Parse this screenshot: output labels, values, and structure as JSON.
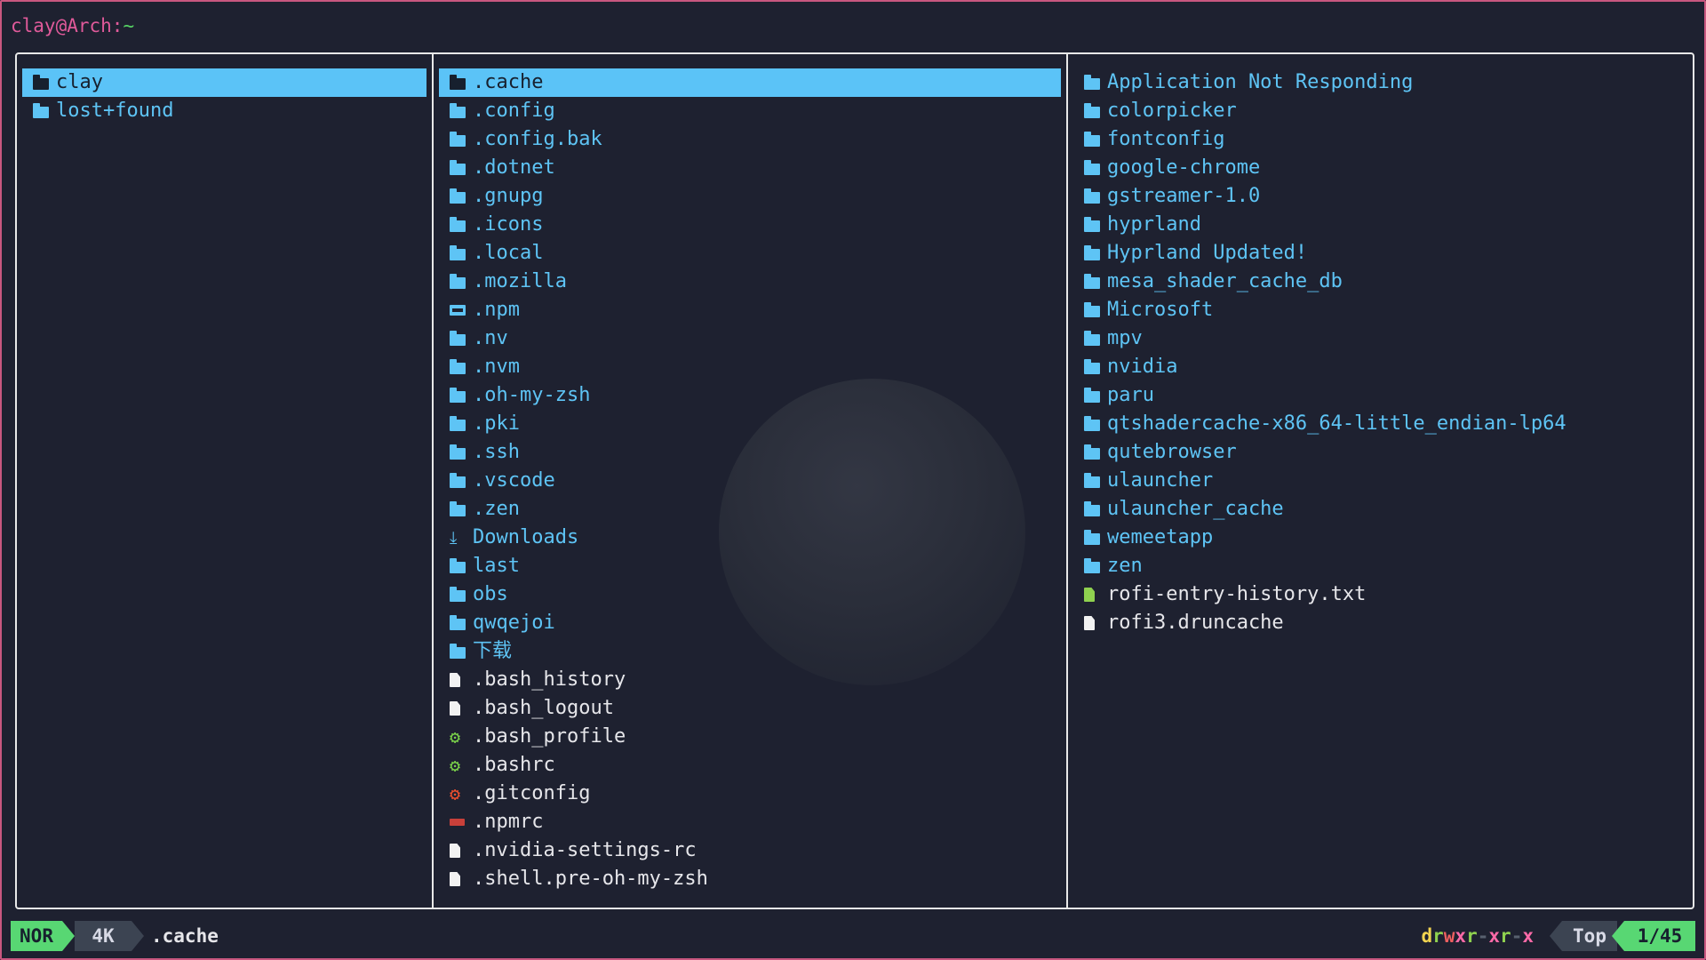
{
  "title": {
    "user_host": "clay@Arch:",
    "path": "~"
  },
  "parent_pane": [
    {
      "name": "clay",
      "type": "folder",
      "selected": true
    },
    {
      "name": "lost+found",
      "type": "folder"
    }
  ],
  "current_pane": [
    {
      "name": ".cache",
      "type": "folder",
      "selected": true
    },
    {
      "name": ".config",
      "type": "folder"
    },
    {
      "name": ".config.bak",
      "type": "folder"
    },
    {
      "name": ".dotnet",
      "type": "folder"
    },
    {
      "name": ".gnupg",
      "type": "folder"
    },
    {
      "name": ".icons",
      "type": "folder"
    },
    {
      "name": ".local",
      "type": "folder"
    },
    {
      "name": ".mozilla",
      "type": "folder"
    },
    {
      "name": ".npm",
      "type": "npm-folder"
    },
    {
      "name": ".nv",
      "type": "folder"
    },
    {
      "name": ".nvm",
      "type": "folder"
    },
    {
      "name": ".oh-my-zsh",
      "type": "folder"
    },
    {
      "name": ".pki",
      "type": "folder"
    },
    {
      "name": ".ssh",
      "type": "folder"
    },
    {
      "name": ".vscode",
      "type": "folder"
    },
    {
      "name": ".zen",
      "type": "folder"
    },
    {
      "name": "Downloads",
      "type": "downloads"
    },
    {
      "name": "last",
      "type": "folder"
    },
    {
      "name": "obs",
      "type": "folder"
    },
    {
      "name": "qwqejoi",
      "type": "folder"
    },
    {
      "name": "下载",
      "type": "folder"
    },
    {
      "name": ".bash_history",
      "type": "file"
    },
    {
      "name": ".bash_logout",
      "type": "file"
    },
    {
      "name": ".bash_profile",
      "type": "gear-green"
    },
    {
      "name": ".bashrc",
      "type": "gear-green"
    },
    {
      "name": ".gitconfig",
      "type": "gear-red"
    },
    {
      "name": ".npmrc",
      "type": "npm-file"
    },
    {
      "name": ".nvidia-settings-rc",
      "type": "file"
    },
    {
      "name": ".shell.pre-oh-my-zsh",
      "type": "file"
    }
  ],
  "preview_pane": [
    {
      "name": "Application Not Responding",
      "type": "folder"
    },
    {
      "name": "colorpicker",
      "type": "folder"
    },
    {
      "name": "fontconfig",
      "type": "folder"
    },
    {
      "name": "google-chrome",
      "type": "folder"
    },
    {
      "name": "gstreamer-1.0",
      "type": "folder"
    },
    {
      "name": "hyprland",
      "type": "folder"
    },
    {
      "name": "Hyprland Updated!",
      "type": "folder"
    },
    {
      "name": "mesa_shader_cache_db",
      "type": "folder"
    },
    {
      "name": "Microsoft",
      "type": "folder"
    },
    {
      "name": "mpv",
      "type": "folder"
    },
    {
      "name": "nvidia",
      "type": "folder"
    },
    {
      "name": "paru",
      "type": "folder"
    },
    {
      "name": "qtshadercache-x86_64-little_endian-lp64",
      "type": "folder"
    },
    {
      "name": "qutebrowser",
      "type": "folder"
    },
    {
      "name": "ulauncher",
      "type": "folder"
    },
    {
      "name": "ulauncher_cache",
      "type": "folder"
    },
    {
      "name": "wemeetapp",
      "type": "folder"
    },
    {
      "name": "zen",
      "type": "folder"
    },
    {
      "name": "rofi-entry-history.txt",
      "type": "file-green"
    },
    {
      "name": "rofi3.druncache",
      "type": "file"
    }
  ],
  "status": {
    "mode": "NOR",
    "size": "4K",
    "selected_name": ".cache",
    "perm": {
      "d": "d",
      "r1": "r",
      "w1": "w",
      "x1": "x",
      "r2": "r",
      "x2": "x",
      "r3": "r",
      "x3": "x",
      "dash": "-"
    },
    "position": "Top",
    "count": "1/45"
  },
  "colors": {
    "folder": "#5ec4f5",
    "selection": "#5bc3f7",
    "mode": "#58d773",
    "border": "#c9577f"
  },
  "icons": {
    "folder": "folder-icon",
    "file": "file-icon",
    "file-green": "text-file-icon",
    "gear-green": "settings-file-icon",
    "gear-red": "git-config-icon",
    "npm-folder": "npm-folder-icon",
    "npm-file": "npm-file-icon",
    "downloads": "downloads-folder-icon"
  }
}
